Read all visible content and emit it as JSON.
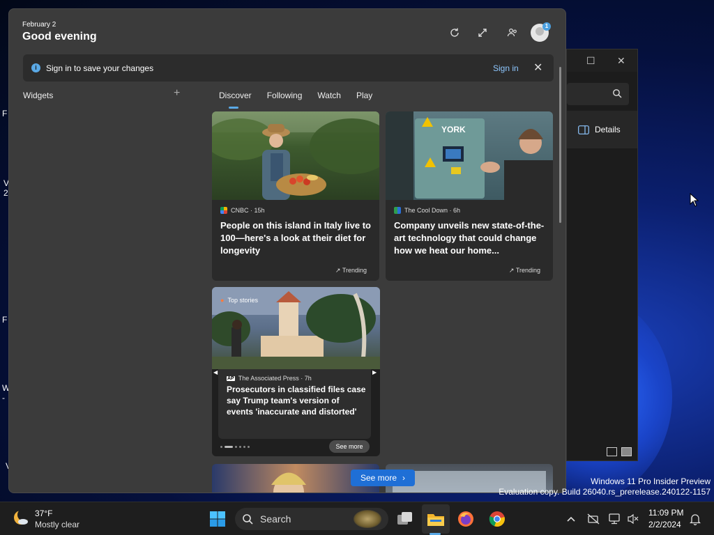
{
  "widgets_panel": {
    "date": "February 2",
    "greeting": "Good evening",
    "header_icons": [
      "refresh-icon",
      "expand-icon",
      "people-icon"
    ],
    "avatar_badge": "1",
    "signin_bar": {
      "message": "Sign in to save your changes",
      "link": "Sign in"
    },
    "widgets_label": "Widgets",
    "tabs": [
      "Discover",
      "Following",
      "Watch",
      "Play"
    ],
    "active_tab": "Discover",
    "cards": [
      {
        "source": "CNBC · 15h",
        "headline": "People on this island in Italy live to 100—here's a look at their diet for longevity",
        "tag": "Trending"
      },
      {
        "source": "The Cool Down · 6h",
        "headline": "Company unveils new state-of-the-art technology that could change how we heat our home...",
        "tag": "Trending",
        "image_text": "YORK"
      }
    ],
    "top_stories": {
      "label": "Top stories",
      "source": "The Associated Press · 7h",
      "source_logo": "AP",
      "headline": "Prosecutors in classified files case say Trump team's version of events 'inaccurate and distorted'",
      "see_more": "See more"
    },
    "see_more_button": "See more"
  },
  "explorer": {
    "details_label": "Details"
  },
  "desktop_fragments": [
    "F",
    "V",
    "2",
    "F",
    "W",
    "-",
    "V"
  ],
  "watermark": {
    "line1": "Windows 11 Pro Insider Preview",
    "line2": "Evaluation copy. Build 26040.rs_prerelease.240122-1157"
  },
  "taskbar": {
    "weather_temp": "37°F",
    "weather_condition": "Mostly clear",
    "search_placeholder": "Search",
    "apps": [
      "start-icon",
      "search",
      "task-view-icon",
      "file-explorer-icon",
      "firefox-icon",
      "chrome-icon"
    ],
    "time": "11:09 PM",
    "date": "2/2/2024"
  },
  "colors": {
    "accent": "#5aa9e6",
    "see_more_button": "#1f6fd6",
    "panel_bg": "#3b3b3b"
  }
}
